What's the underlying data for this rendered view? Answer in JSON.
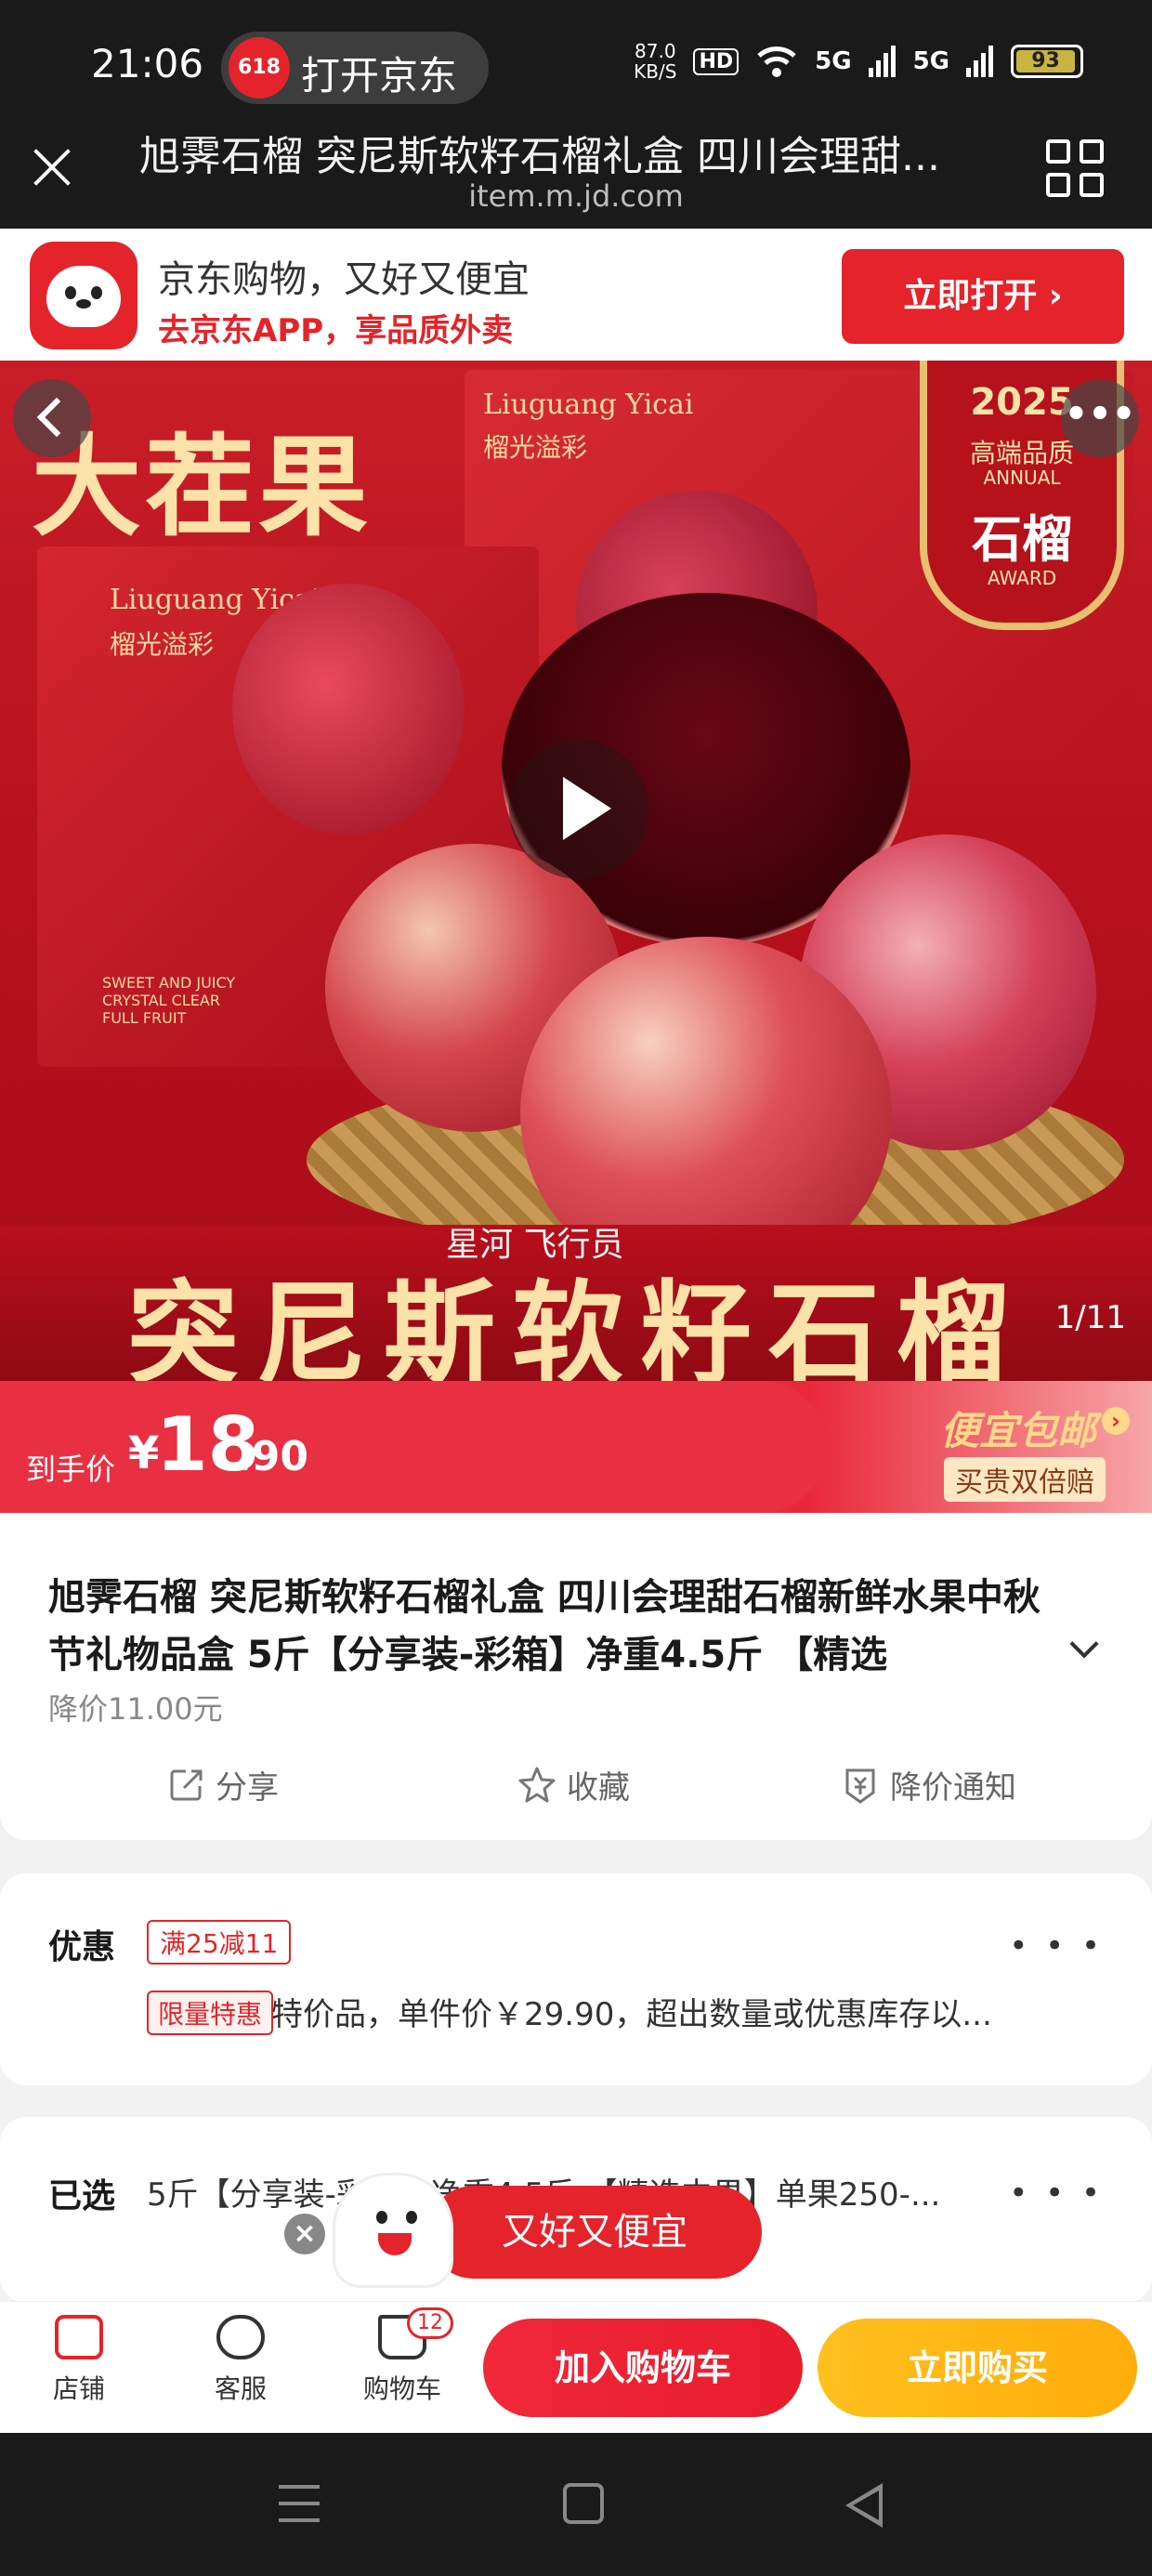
{
  "status_bar": {
    "time": "21:06",
    "jd_badge": "618",
    "open_jd": "打开京东",
    "net_speed_value": "87.0",
    "net_speed_unit": "KB/S",
    "hd": "HD",
    "signal1": "5G",
    "signal2": "5G",
    "battery": "93"
  },
  "browser": {
    "title": "旭霁石榴 突尼斯软籽石榴礼盒 四川会理甜...",
    "url": "item.m.jd.com"
  },
  "app_banner": {
    "line1": "京东购物，又好又便宜",
    "line2": "去京东APP，享品质外卖",
    "open_button": "立即打开 ›"
  },
  "hero": {
    "headline": "大茬果",
    "brand_en": "Liuguang Yicai",
    "brand_cn": "榴光溢彩",
    "award_year": "2025",
    "award_grade": "高端品质",
    "award_annual": "ANNUAL",
    "award_name": "石榴",
    "award_award": "AWARD",
    "small_text": "SWEET AND JUICY CRYSTAL CLEAR FULL FRUIT",
    "watermark": "星河 飞行员",
    "banner_text": "突尼斯软籽石榴",
    "counter": "1/11"
  },
  "price": {
    "label": "到手价",
    "currency": "¥",
    "integer": "18",
    "decimal": ".90",
    "cheap_ship": "便宜包邮",
    "arrow": "›",
    "pay_more": "买贵双倍赔"
  },
  "product": {
    "title": "旭霁石榴 突尼斯软籽石榴礼盒 四川会理甜石榴新鲜水果中秋节礼物品盒 5斤【分享装-彩箱】净重4.5斤 【精选",
    "drop": "降价11.00元",
    "share": "分享",
    "favorite": "收藏",
    "price_alert": "降价通知"
  },
  "promo": {
    "label": "优惠",
    "tag": "满25减11",
    "limited": "限量特惠",
    "desc": "特价品，单件价￥29.90，超出数量或优惠库存以...",
    "dots": "• • •"
  },
  "selected": {
    "label": "已选",
    "value": "5斤【分享装-彩箱】净重4.5斤 【精选中果】单果250-...",
    "dots": "• • •"
  },
  "floating": {
    "close": "×",
    "text": "又好又便宜"
  },
  "bottom_bar": {
    "store": "店铺",
    "service": "客服",
    "cart": "购物车",
    "cart_count": "12",
    "add_to_cart": "加入购物车",
    "buy_now": "立即购买"
  },
  "colors": {
    "jd_red": "#e4242a",
    "buy_yellow": "#ffb514",
    "gold_text": "#fbe2a8"
  }
}
